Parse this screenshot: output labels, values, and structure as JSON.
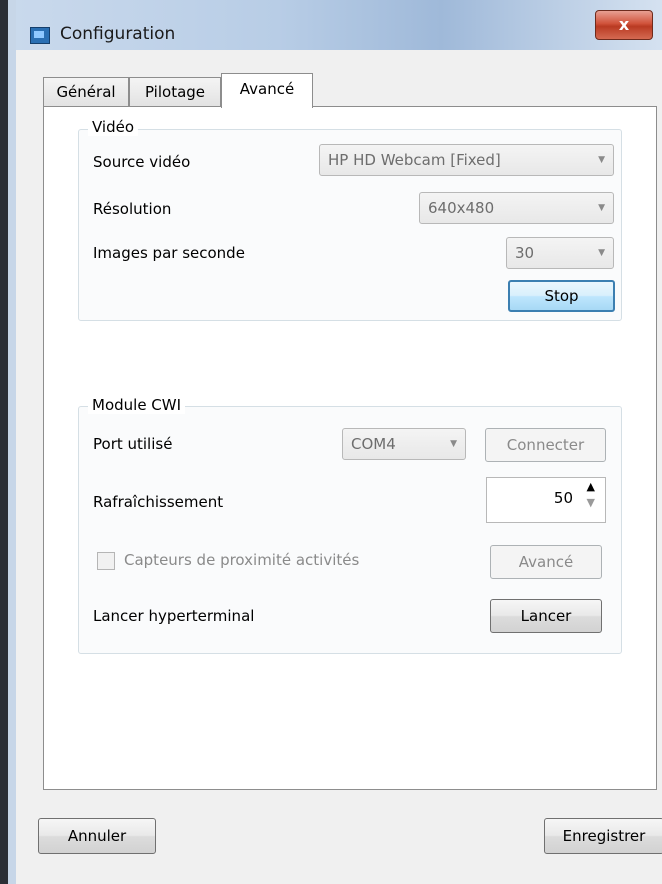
{
  "window": {
    "title": "Configuration",
    "close_label": "x"
  },
  "tabs": [
    {
      "label": "Général",
      "active": false
    },
    {
      "label": "Pilotage",
      "active": false
    },
    {
      "label": "Avancé",
      "active": true
    }
  ],
  "video": {
    "group_label": "Vidéo",
    "source_label": "Source vidéo",
    "source_value": "HP HD Webcam [Fixed]",
    "resolution_label": "Résolution",
    "resolution_value": "640x480",
    "fps_label": "Images par seconde",
    "fps_value": "30",
    "stop_label": "Stop"
  },
  "cwi": {
    "group_label": "Module CWI",
    "port_label": "Port utilisé",
    "port_value": "COM4",
    "connect_label": "Connecter",
    "refresh_label": "Rafraîchissement",
    "refresh_value": "50",
    "proximity_label": "Capteurs de proximité activités",
    "advanced_label": "Avancé",
    "hyperterminal_label": "Lancer hyperterminal",
    "launch_label": "Lancer"
  },
  "footer": {
    "cancel_label": "Annuler",
    "save_label": "Enregistrer"
  },
  "colors": {
    "focus_border": "#3c7fb1",
    "close_button": "#c8452c",
    "disabled_text": "#8a8a8a"
  }
}
